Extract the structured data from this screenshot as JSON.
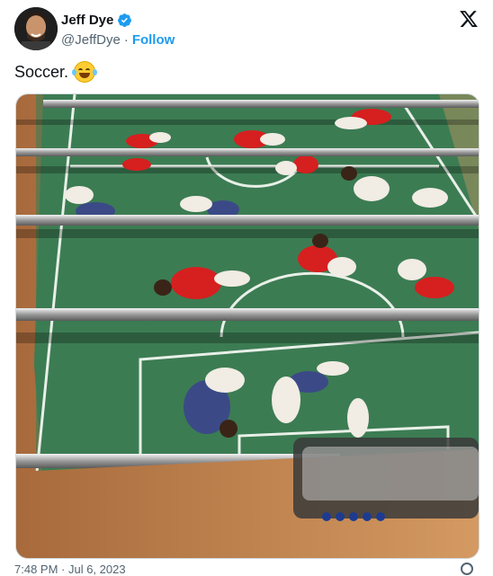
{
  "user": {
    "display_name": "Jeff Dye",
    "handle": "@JeffDye",
    "separator": "·",
    "follow_label": "Follow",
    "verified_color": "#1d9bf0"
  },
  "tweet": {
    "text": "Soccer.",
    "emoji": "face-with-tears-of-joy",
    "image_description": "foosball-table-figures-lying-down"
  },
  "footer": {
    "timestamp_partial": "7:48 PM · Jul 6, 2023"
  },
  "icons": {
    "brand": "x-logo-icon",
    "info": "info-icon"
  },
  "colors": {
    "accent": "#1d9bf0",
    "field": "#3b7a52",
    "red_team": "#d61f1f",
    "blue_team": "#3b4a86"
  }
}
